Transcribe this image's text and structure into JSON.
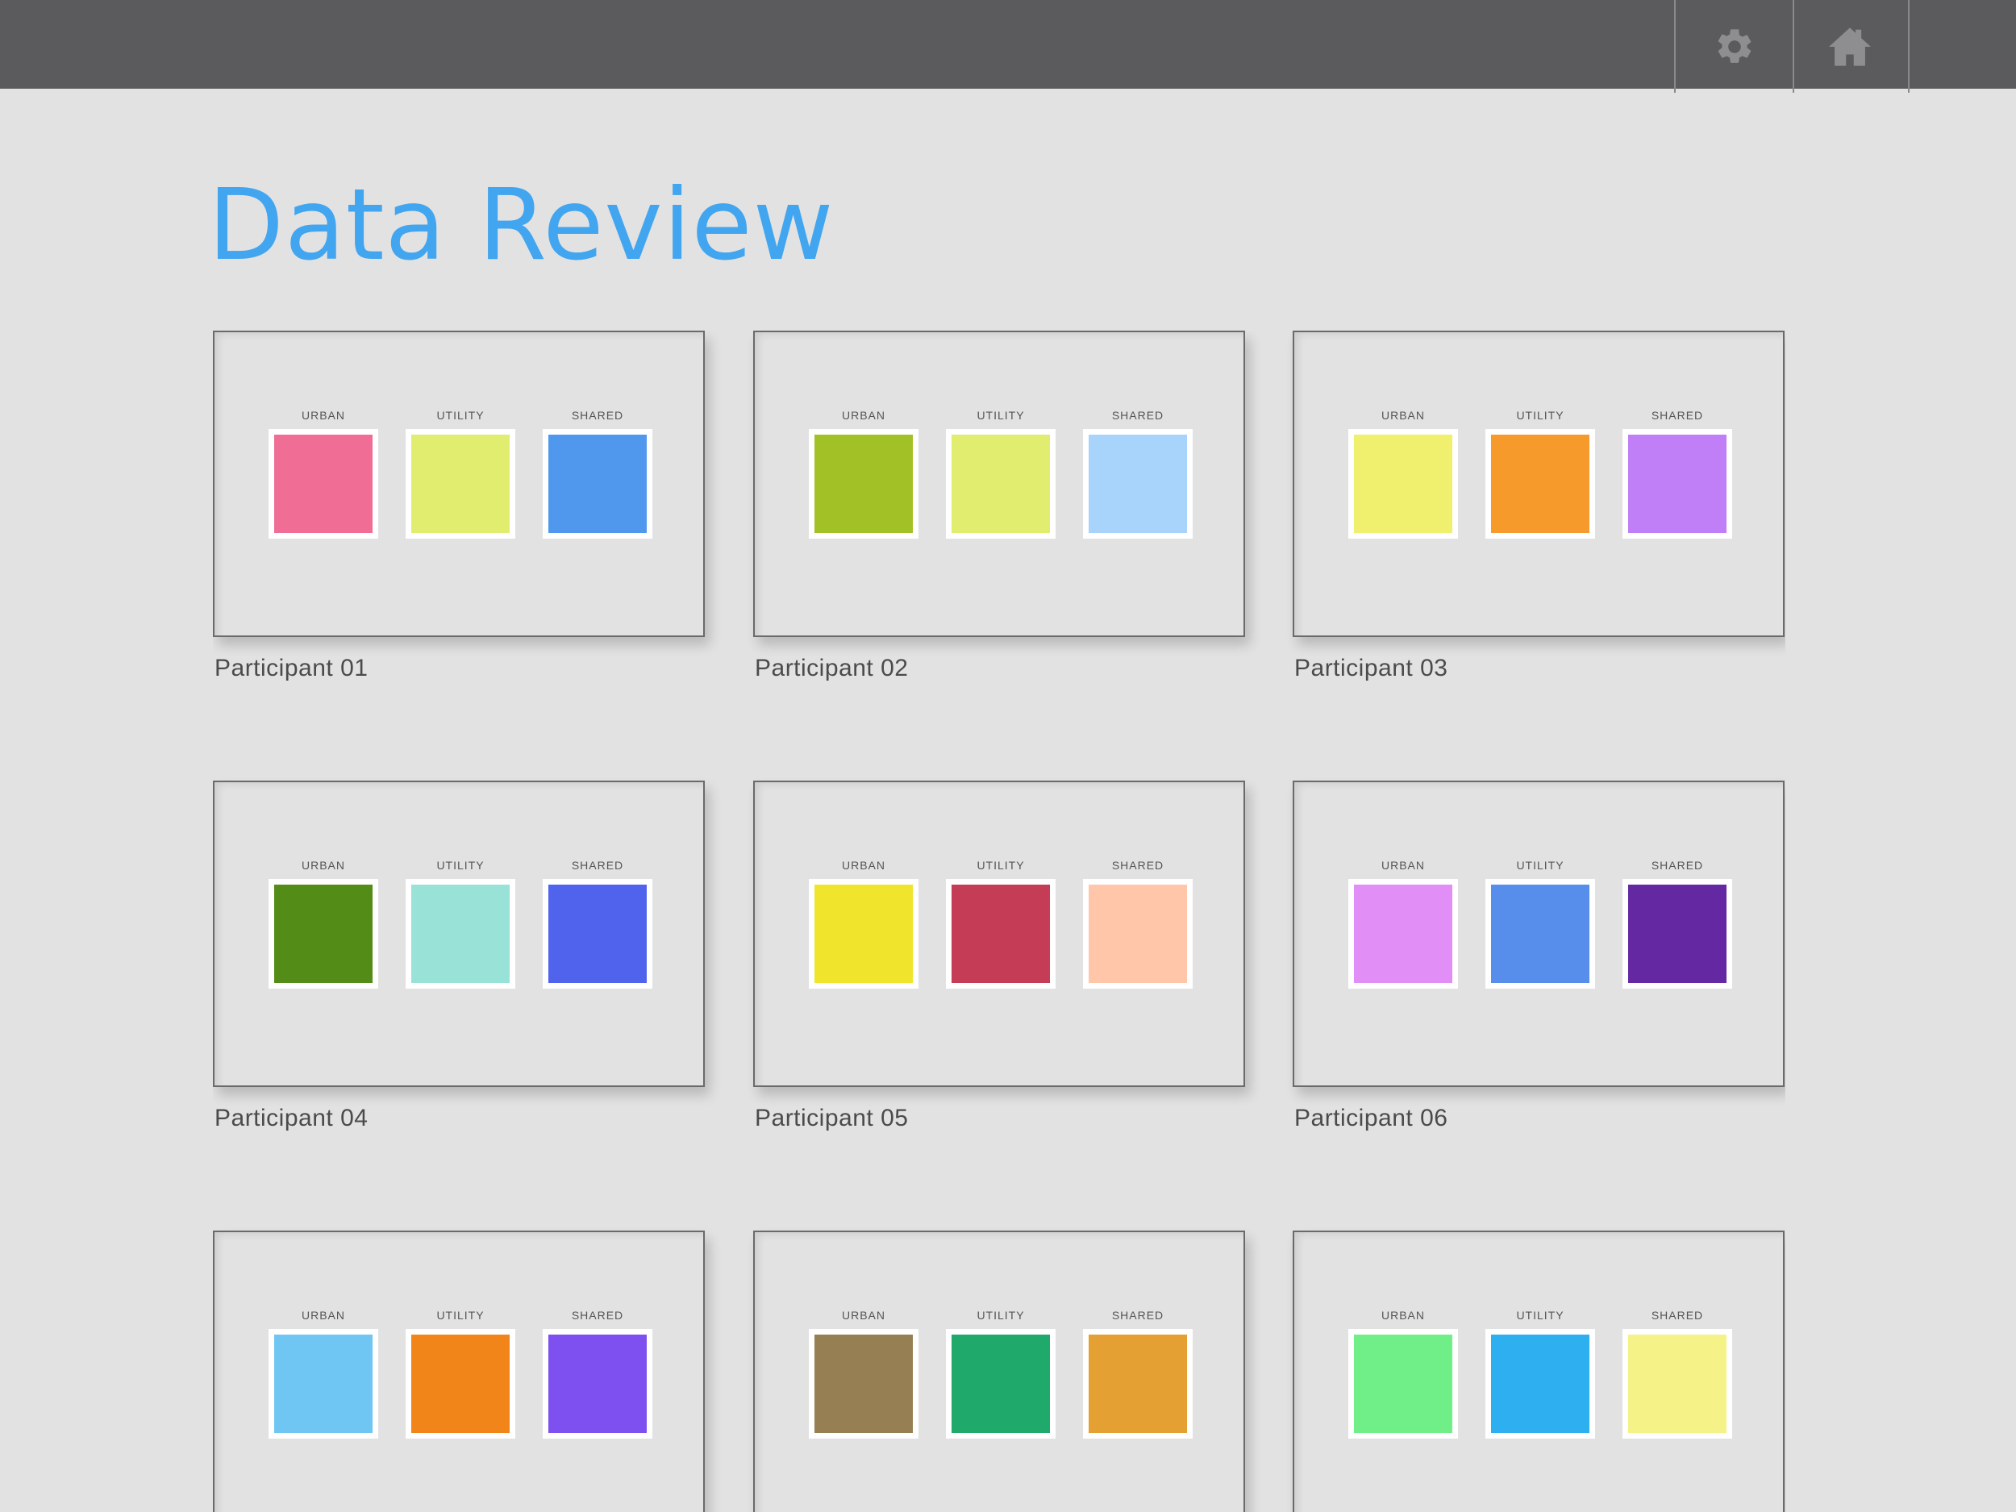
{
  "page": {
    "title": "Data Review"
  },
  "toolbar": {
    "settings_icon": "gear-icon",
    "home_icon": "home-icon"
  },
  "labels": {
    "urban": "URBAN",
    "utility": "UTILITY",
    "shared": "SHARED"
  },
  "participants": [
    {
      "name": "Participant 01",
      "urban": "#f06e96",
      "utility": "#e0ed6e",
      "shared": "#5098ed"
    },
    {
      "name": "Participant 02",
      "urban": "#a2c126",
      "utility": "#e0ed6e",
      "shared": "#a8d4fc"
    },
    {
      "name": "Participant 03",
      "urban": "#f0ef6e",
      "utility": "#f79a2c",
      "shared": "#c07ef7"
    },
    {
      "name": "Participant 04",
      "urban": "#538c17",
      "utility": "#98e2d8",
      "shared": "#5063ed"
    },
    {
      "name": "Participant 05",
      "urban": "#f0e52c",
      "utility": "#c43c55",
      "shared": "#ffc6aa"
    },
    {
      "name": "Participant 06",
      "urban": "#e28ef7",
      "utility": "#588eeb",
      "shared": "#6428a2"
    },
    {
      "name": "",
      "urban": "#70c6f2",
      "utility": "#f2851a",
      "shared": "#7d50ef"
    },
    {
      "name": "",
      "urban": "#967f52",
      "utility": "#1fa96b",
      "shared": "#e5a033"
    },
    {
      "name": "",
      "urban": "#70ef88",
      "utility": "#2eaff0",
      "shared": "#f5f288"
    }
  ]
}
